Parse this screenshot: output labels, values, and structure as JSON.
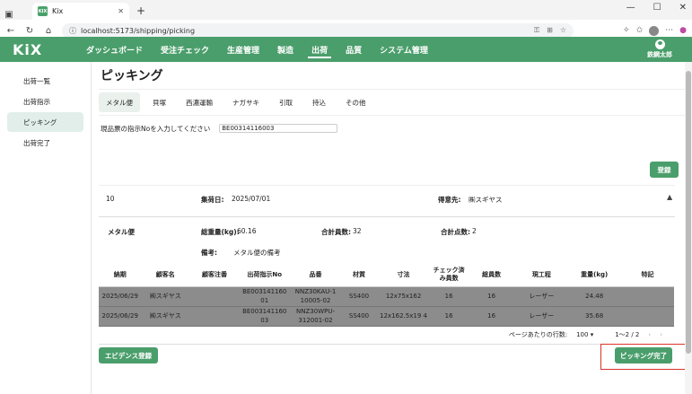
{
  "browser": {
    "tab_title": "Kix",
    "favicon_text": "KIX",
    "url": "localhost:5173/shipping/picking"
  },
  "header": {
    "logo": "KiX",
    "menu": [
      "ダッシュボード",
      "受注チェック",
      "生産管理",
      "製造",
      "出荷",
      "品質",
      "システム管理"
    ],
    "user_name": "鉄鋼太郎"
  },
  "sidebar": {
    "items": [
      "出荷一覧",
      "出荷指示",
      "ピッキング",
      "出荷完了"
    ]
  },
  "page": {
    "title": "ピッキング",
    "tabs": [
      "メタル便",
      "貝塚",
      "西濃運輸",
      "ナガサキ",
      "引取",
      "持込",
      "その他"
    ],
    "input_label": "現品票の指示Noを入力してください",
    "input_value": "BE00314116003",
    "register_button": "登録"
  },
  "summary": {
    "number": "10",
    "collect_label": "集荷日:",
    "collect_date": "2025/07/01",
    "customer_label": "得意先:",
    "customer": "㈱スギヤス",
    "carrier": "メタル便",
    "weight_label": "総重量(kg):",
    "weight_value": "60.16",
    "total_count_label": "合計員数:",
    "total_count": "32",
    "total_points_label": "合計点数:",
    "total_points": "2",
    "memo_label": "備考:",
    "memo": "メタル便の備考"
  },
  "table": {
    "headers": [
      "納期",
      "顧客名",
      "顧客注番",
      "出荷指示No",
      "品番",
      "材質",
      "寸法",
      "チェック済み員数",
      "総員数",
      "現工程",
      "重量(kg)",
      "特記"
    ],
    "rows": [
      [
        "2025/06/29",
        "㈱スギヤス",
        "",
        "BE003141160 01",
        "NNZ30KAU-1 10005-02",
        "SS400",
        "12x75x162",
        "16",
        "16",
        "レーザー",
        "24.48",
        ""
      ],
      [
        "2025/06/29",
        "㈱スギヤス",
        "",
        "BE003141160 03",
        "NNZ30WPU- 312001-02",
        "SS400",
        "12x162.5x19 4",
        "16",
        "16",
        "レーザー",
        "35.68",
        ""
      ]
    ],
    "rows_per_page_label": "ページあたりの行数:",
    "rows_per_page": "100",
    "range": "1〜2 / 2"
  },
  "footer": {
    "evidence_button": "エビデンス登録",
    "complete_button": "ピッキング完了"
  },
  "colors": {
    "brand": "#4a9e6b",
    "highlight": "#d9342b"
  }
}
